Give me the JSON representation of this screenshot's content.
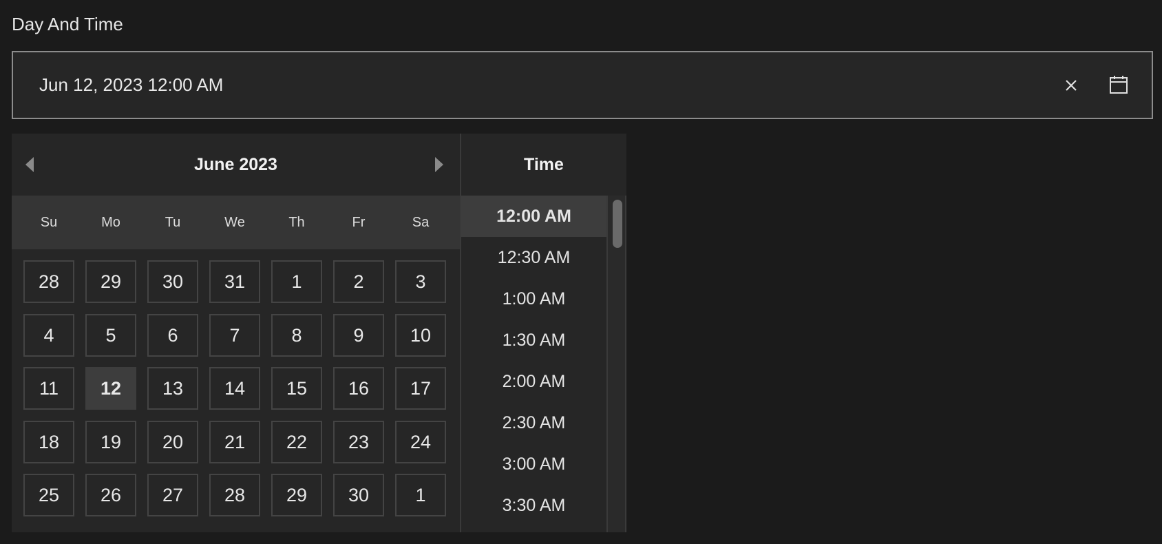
{
  "field": {
    "label": "Day And Time",
    "value": "Jun 12, 2023 12:00 AM",
    "clear_icon": "close-icon",
    "calendar_icon": "calendar-icon"
  },
  "calendar": {
    "month_title": "June 2023",
    "prev_icon": "caret-left-icon",
    "next_icon": "caret-right-icon",
    "weekdays": [
      "Su",
      "Mo",
      "Tu",
      "We",
      "Th",
      "Fr",
      "Sa"
    ],
    "weeks": [
      [
        "28",
        "29",
        "30",
        "31",
        "1",
        "2",
        "3"
      ],
      [
        "4",
        "5",
        "6",
        "7",
        "8",
        "9",
        "10"
      ],
      [
        "11",
        "12",
        "13",
        "14",
        "15",
        "16",
        "17"
      ],
      [
        "18",
        "19",
        "20",
        "21",
        "22",
        "23",
        "24"
      ],
      [
        "25",
        "26",
        "27",
        "28",
        "29",
        "30",
        "1"
      ]
    ],
    "selected_day": "12"
  },
  "time": {
    "title": "Time",
    "options": [
      "12:00 AM",
      "12:30 AM",
      "1:00 AM",
      "1:30 AM",
      "2:00 AM",
      "2:30 AM",
      "3:00 AM",
      "3:30 AM"
    ],
    "selected": "12:00 AM"
  },
  "colors": {
    "background": "#1b1b1b",
    "surface": "#262626",
    "selected": "#3d3d3d",
    "field_border": "#8c8c8c"
  }
}
